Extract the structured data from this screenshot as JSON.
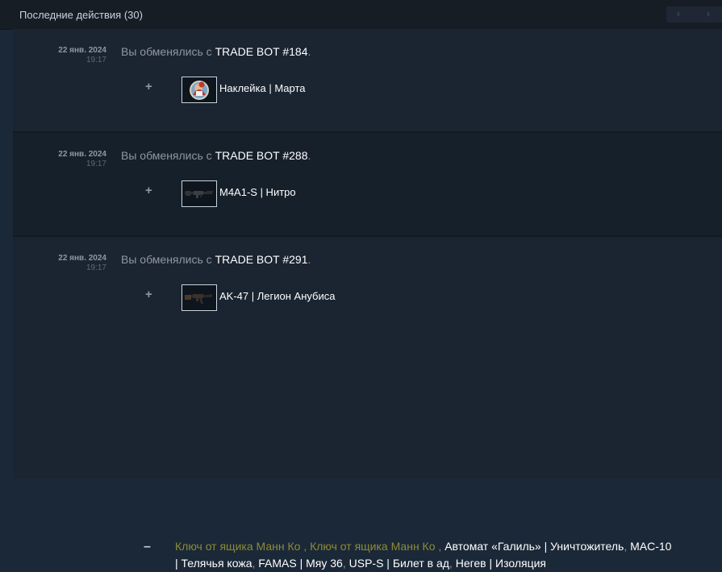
{
  "header": {
    "title": "Последние действия (30)",
    "pager_prev": "‹",
    "pager_next": "›"
  },
  "trades": [
    {
      "date": "22 янв. 2024",
      "time": "19:17",
      "desc_prefix": "Вы обменялись с ",
      "partner": "TRADE BOT #184",
      "desc_suffix": ".",
      "received_marker": "+",
      "received_item": "Наклейка | Марта"
    },
    {
      "date": "22 янв. 2024",
      "time": "19:17",
      "desc_prefix": "Вы обменялись с ",
      "partner": "TRADE BOT #288",
      "desc_suffix": ".",
      "received_marker": "+",
      "received_item": "M4A1-S | Нитро"
    },
    {
      "date": "22 янв. 2024",
      "time": "19:17",
      "desc_prefix": "Вы обменялись с ",
      "partner": "TRADE BOT #291",
      "desc_suffix": ".",
      "received_marker": "+",
      "received_item": "AK-47 | Легион Анубиса",
      "given_marker": "–",
      "given_items": [
        "Ключ от ящика Манн Ко",
        "Ключ от ящика Манн Ко",
        "Автомат «Галиль» | Уничтожитель",
        "MAC-10 | Телячья кожа",
        "FAMAS | Мяу 36",
        "USP-S | Билет в ад",
        "Негев | Изоляция"
      ],
      "separator": ","
    }
  ],
  "colors": {
    "background": "#1b2838",
    "key_item": "#8c8c34",
    "partner_text": "#ffffff"
  },
  "icons": {
    "sticker": "sticker-marta-icon",
    "rifle_m4": "m4a1s-rifle-icon",
    "rifle_ak": "ak47-rifle-icon"
  }
}
